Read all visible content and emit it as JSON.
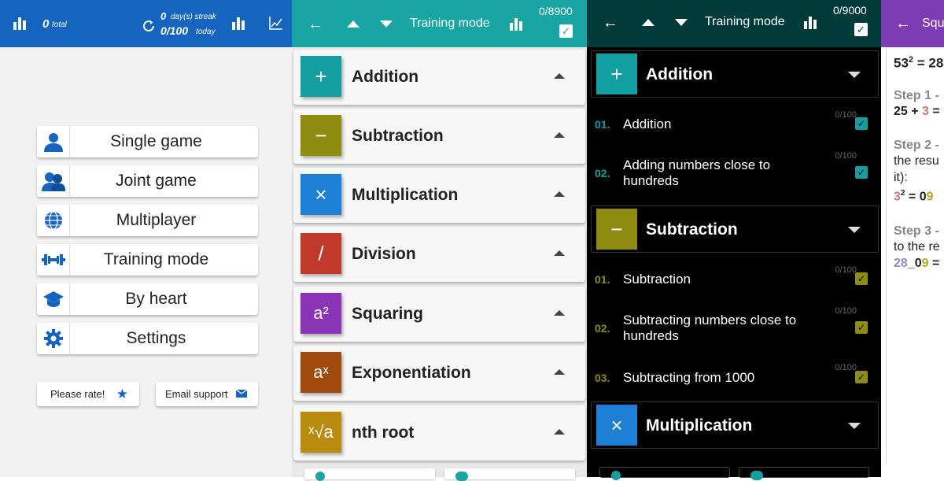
{
  "p1": {
    "total_value": "0",
    "total_label": "total",
    "streak_value": "0",
    "streak_label": "day(s) streak",
    "today_value": "0/100",
    "today_label": "today",
    "menu": [
      {
        "label": "Single game",
        "icon": "person-icon"
      },
      {
        "label": "Joint game",
        "icon": "people-icon"
      },
      {
        "label": "Multiplayer",
        "icon": "globe-icon"
      },
      {
        "label": "Training mode",
        "icon": "dumbbell-icon"
      },
      {
        "label": "By heart",
        "icon": "graduation-cap-icon"
      },
      {
        "label": "Settings",
        "icon": "gear-icon"
      }
    ],
    "rate_label": "Please rate!",
    "email_label": "Email support"
  },
  "p2": {
    "title": "Training mode",
    "counter": "0/8900",
    "categories": [
      {
        "name": "Addition",
        "symbol": "+",
        "color": "#139fa2"
      },
      {
        "name": "Subtraction",
        "symbol": "−",
        "color": "#8f8c11"
      },
      {
        "name": "Multiplication",
        "symbol": "×",
        "color": "#1d7fd6"
      },
      {
        "name": "Division",
        "symbol": "/",
        "color": "#c0392b"
      },
      {
        "name": "Squaring",
        "symbol": "a²",
        "color": "#8a35b5"
      },
      {
        "name": "Exponentiation",
        "symbol": "aˣ",
        "color": "#a14a0e"
      },
      {
        "name": "nth root",
        "symbol": "ˣ√a",
        "color": "#b98c10"
      }
    ]
  },
  "p3": {
    "title": "Training mode",
    "counter": "0/9000",
    "addition": {
      "name": "Addition",
      "symbol": "+",
      "color": "#139fa2"
    },
    "subtraction": {
      "name": "Subtraction",
      "symbol": "−",
      "color": "#8f8c11"
    },
    "multiplication": {
      "name": "Multiplication",
      "symbol": "×",
      "color": "#1d7fd6"
    },
    "add_items": [
      {
        "num": "01.",
        "text": "Addition",
        "score": "0/100"
      },
      {
        "num": "02.",
        "text": "Adding numbers close to hundreds",
        "score": "0/100"
      }
    ],
    "sub_items": [
      {
        "num": "01.",
        "text": "Subtraction",
        "score": "0/100"
      },
      {
        "num": "02.",
        "text": "Subtracting numbers close to hundreds",
        "score": "0/100"
      },
      {
        "num": "03.",
        "text": "Subtracting from 1000",
        "score": "0/100"
      }
    ]
  },
  "p4": {
    "title": "Squ",
    "formula_a": "53",
    "formula_b": "2",
    "formula_c": " = 28",
    "step1": "Step 1 -",
    "step1_line": "25 + 3 =",
    "step2": "Step 2 -",
    "step2_l1": "the resu",
    "step2_l2": "it):",
    "step2_l3": "3² = 09",
    "step3": "Step 3 -",
    "step3_l1": "to the re",
    "step3_l2": "28_09 ="
  }
}
